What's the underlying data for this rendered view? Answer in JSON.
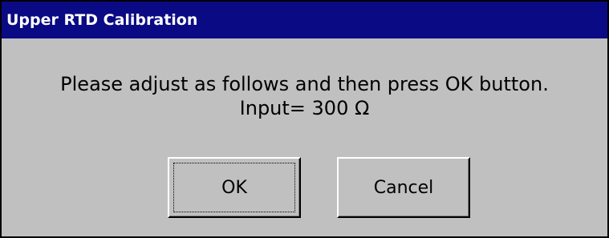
{
  "dialog": {
    "title": "Upper RTD Calibration",
    "message_line1": "Please adjust as follows and then press OK button.",
    "message_line2": "Input= 300 Ω",
    "ok_label": "OK",
    "cancel_label": "Cancel"
  },
  "colors": {
    "titlebar": "#0a0a84",
    "title_text": "#ffffff",
    "background": "#c0c0c0"
  }
}
